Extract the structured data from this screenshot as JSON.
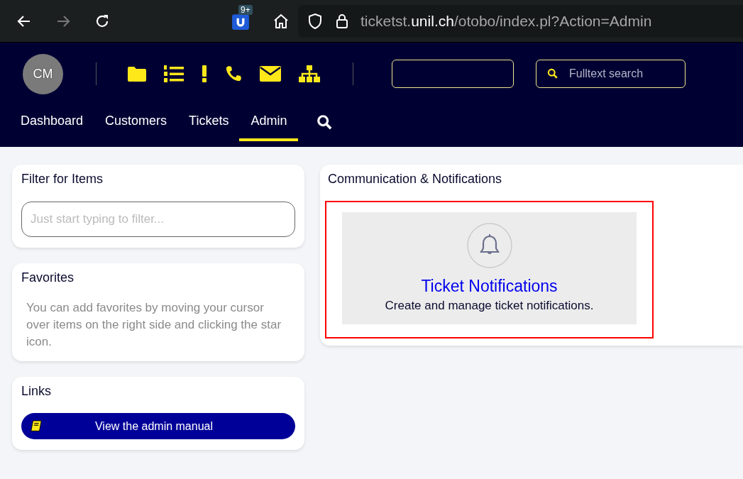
{
  "browser": {
    "extension_badge": "9+",
    "url": {
      "host_prefix": "ticketst.",
      "domain": "unil.ch",
      "path": "/otobo/index.pl?Action=Admin"
    }
  },
  "header": {
    "avatar": "CM",
    "toolbar_icons": [
      {
        "kind": "folder"
      },
      {
        "kind": "list"
      },
      {
        "kind": "alert"
      },
      {
        "kind": "phone"
      },
      {
        "kind": "mail"
      },
      {
        "kind": "sitemap"
      }
    ],
    "search_placeholder": "Fulltext search"
  },
  "nav": [
    {
      "label": "Dashboard",
      "selected": false
    },
    {
      "label": "Customers",
      "selected": false
    },
    {
      "label": "Tickets",
      "selected": false
    },
    {
      "label": "Admin",
      "selected": true
    }
  ],
  "sidebar": {
    "filter": {
      "title": "Filter for Items",
      "placeholder": "Just start typing to filter..."
    },
    "favorites": {
      "title": "Favorites",
      "text": "You can add favorites by moving your cursor over items on the right side and clicking the star icon."
    },
    "links": {
      "title": "Links",
      "button": "View the admin manual"
    }
  },
  "section": {
    "title": "Communication & Notifications",
    "items": [
      {
        "title": "Ticket Notifications",
        "description": "Create and manage ticket notifications.",
        "highlighted": true
      }
    ]
  }
}
